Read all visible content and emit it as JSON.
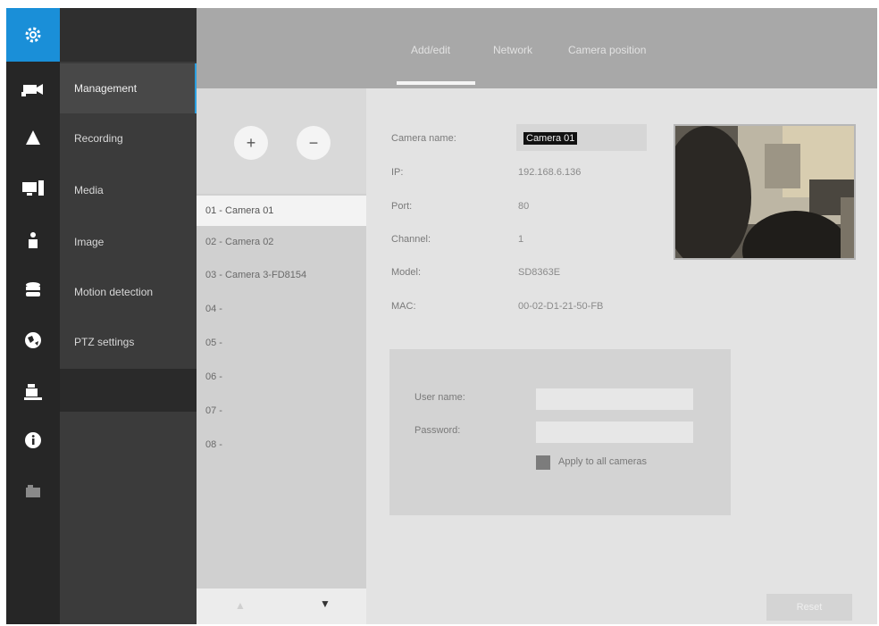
{
  "sidebar_icons": [
    "gear-icon",
    "camera-icon",
    "alarm-icon",
    "display-icon",
    "user-icon",
    "storage-icon",
    "network-icon",
    "system-icon",
    "info-icon",
    "folder-icon"
  ],
  "menu": {
    "items": [
      {
        "label": "Management",
        "active": true
      },
      {
        "label": "Recording",
        "active": false
      },
      {
        "label": "Media",
        "active": false
      },
      {
        "label": "Image",
        "active": false
      },
      {
        "label": "Motion detection",
        "active": false
      },
      {
        "label": "PTZ settings",
        "active": false
      }
    ]
  },
  "tabs": [
    {
      "label": "Add/edit",
      "active": true
    },
    {
      "label": "Network",
      "active": false
    },
    {
      "label": "Camera position",
      "active": false
    }
  ],
  "camera_list": {
    "add_label": "+",
    "remove_label": "−",
    "items": [
      {
        "label": "01 - Camera 01",
        "selected": true
      },
      {
        "label": "02 - Camera 02",
        "selected": false
      },
      {
        "label": "03 - Camera 3-FD8154",
        "selected": false
      },
      {
        "label": "04 -",
        "selected": false
      },
      {
        "label": "05 -",
        "selected": false
      },
      {
        "label": "06 -",
        "selected": false
      },
      {
        "label": "07 -",
        "selected": false
      },
      {
        "label": "08 -",
        "selected": false
      }
    ],
    "scroll_up": "▲",
    "scroll_down": "▼"
  },
  "details": {
    "camera_name_label": "Camera name:",
    "camera_name_value": "Camera 01",
    "ip_label": "IP:",
    "ip_value": "192.168.6.136",
    "port_label": "Port:",
    "port_value": "80",
    "channel_label": "Channel:",
    "channel_value": "1",
    "model_label": "Model:",
    "model_value": "SD8363E",
    "mac_label": "MAC:",
    "mac_value": "00-02-D1-21-50-FB"
  },
  "auth": {
    "username_label": "User name:",
    "username_value": "",
    "password_label": "Password:",
    "password_value": "",
    "apply_label": "Apply to all cameras"
  },
  "reset_label": "Reset",
  "colors": {
    "accent": "#1a8fd8",
    "rail": "#262626",
    "menu": "#3b3b3b",
    "topbar": "#a8a8a8"
  }
}
